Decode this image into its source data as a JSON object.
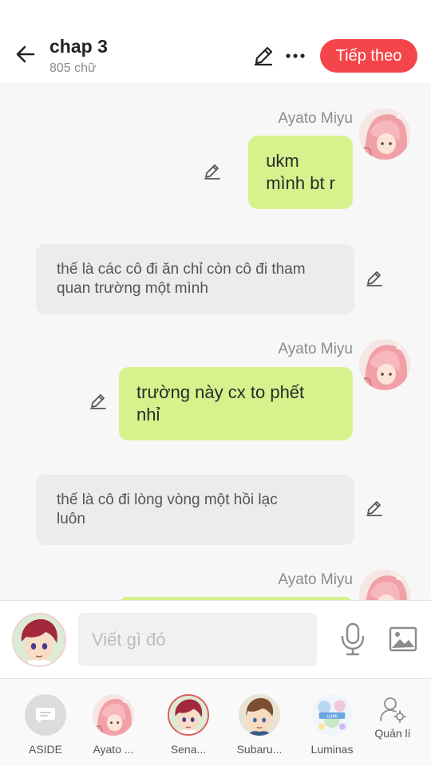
{
  "header": {
    "title": "chap 3",
    "word_count": "805 chữ",
    "next_label": "Tiếp theo",
    "icons": [
      "back-arrow-icon",
      "pencil-icon",
      "more-dots-icon"
    ],
    "accent_color": "#f4454a"
  },
  "messages": [
    {
      "type": "character",
      "name": "Ayato  Miyu",
      "text": "ukm\nmình bt r"
    },
    {
      "type": "narration",
      "text": "thế là các cô đi ăn chỉ còn cô đi tham\nquan trường một mình"
    },
    {
      "type": "character",
      "name": "Ayato  Miyu",
      "text": "trường này cx to phết\nnhỉ"
    },
    {
      "type": "narration",
      "text": "thế là cô đi lòng vòng một hồi lạc\nluôn"
    },
    {
      "type": "character",
      "name": "Ayato  Miyu",
      "text": ""
    }
  ],
  "colors": {
    "my_bubble": "#d6f28c",
    "narration_bubble": "#ececec"
  },
  "composer": {
    "placeholder": "Viết gì đó",
    "value": "",
    "icons": [
      "microphone-icon",
      "image-icon"
    ]
  },
  "characters": [
    {
      "label": "ASIDE",
      "icon": "aside-chat-icon"
    },
    {
      "label": "Ayato ..."
    },
    {
      "label": "Sena..."
    },
    {
      "label": "Subaru..."
    },
    {
      "label": "Luminas"
    },
    {
      "label": "Quản lí",
      "icon": "user-settings-icon"
    }
  ]
}
